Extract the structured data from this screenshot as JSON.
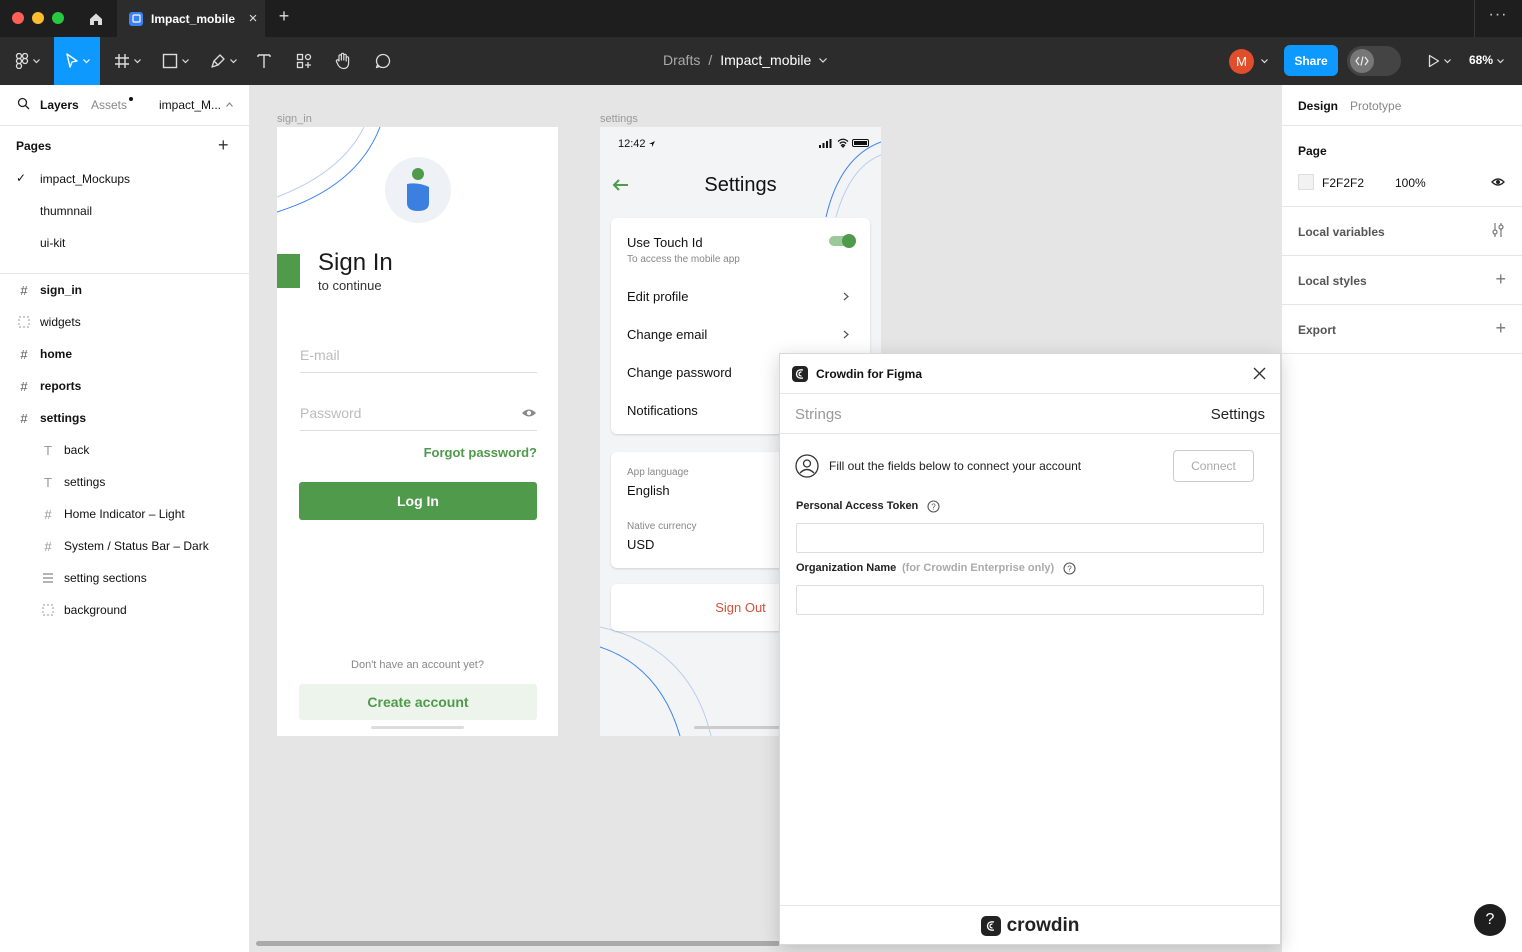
{
  "titlebar": {
    "tab_title": "Impact_mobile",
    "tab_close": "×",
    "new_tab": "+",
    "more": "···"
  },
  "toolbar": {
    "crumb_root": "Drafts",
    "crumb_sep": "/",
    "crumb_file": "Impact_mobile",
    "avatar_initial": "M",
    "share_label": "Share",
    "zoom": "68%"
  },
  "left_panel": {
    "tab_layers": "Layers",
    "tab_assets": "Assets",
    "page_selector": "impact_M...",
    "pages_heading": "Pages",
    "pages": [
      "impact_Mockups",
      "thumnnail",
      "ui-kit"
    ],
    "layers": [
      {
        "label": "sign_in",
        "icon": "frame-icon",
        "indent": 0
      },
      {
        "label": "widgets",
        "icon": "section-icon",
        "indent": 0
      },
      {
        "label": "home",
        "icon": "frame-icon",
        "indent": 0
      },
      {
        "label": "reports",
        "icon": "frame-icon",
        "indent": 0
      },
      {
        "label": "settings",
        "icon": "frame-icon",
        "indent": 0
      },
      {
        "label": "back",
        "icon": "text-icon",
        "indent": 1
      },
      {
        "label": "settings",
        "icon": "text-icon",
        "indent": 1
      },
      {
        "label": "Home Indicator – Light",
        "icon": "frame-icon",
        "indent": 1
      },
      {
        "label": "System / Status Bar – Dark",
        "icon": "frame-icon",
        "indent": 1
      },
      {
        "label": "setting sections",
        "icon": "auto-layout-icon",
        "indent": 1
      },
      {
        "label": "background",
        "icon": "section-icon",
        "indent": 1
      }
    ]
  },
  "canvas": {
    "signin_label": "sign_in",
    "settings_label": "settings",
    "signin": {
      "title": "Sign In",
      "subtitle": "to continue",
      "email_placeholder": "E-mail",
      "password_placeholder": "Password",
      "forgot": "Forgot password?",
      "login": "Log In",
      "no_account": "Don't have an account yet?",
      "create": "Create account",
      "accent": "#4f9a4b"
    },
    "settings": {
      "time": "12:42",
      "title": "Settings",
      "touch_id_title": "Use Touch Id",
      "touch_id_sub": "To access the mobile app",
      "items": [
        "Edit profile",
        "Change email",
        "Change password",
        "Notifications"
      ],
      "app_language_label": "App language",
      "app_language_value": "English",
      "currency_label": "Native currency",
      "currency_value": "USD",
      "sign_out": "Sign Out"
    }
  },
  "right_panel": {
    "tab_design": "Design",
    "tab_prototype": "Prototype",
    "page_heading": "Page",
    "page_color": "F2F2F2",
    "page_opacity": "100%",
    "local_variables": "Local variables",
    "local_styles": "Local styles",
    "export": "Export"
  },
  "plugin": {
    "title": "Crowdin for Figma",
    "tab_strings": "Strings",
    "tab_settings": "Settings",
    "intro": "Fill out the fields below to connect your account",
    "connect": "Connect",
    "token_label": "Personal Access Token",
    "org_label": "Organization Name",
    "org_hint": "(for Crowdin Enterprise only)",
    "token_value": "",
    "org_value": "",
    "footer_brand": "crowdin"
  },
  "help": "?"
}
